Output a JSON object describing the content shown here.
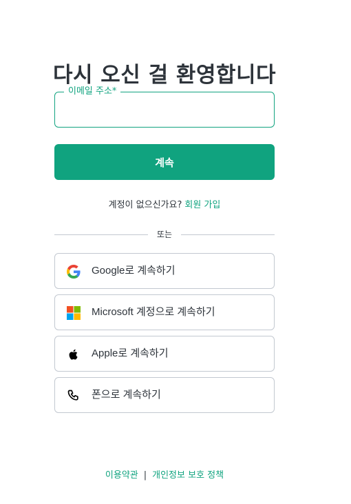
{
  "title": "다시 오신 걸 환영합니다",
  "email": {
    "label": "이메일 주소*",
    "value": "",
    "placeholder": ""
  },
  "continue_label": "계속",
  "signup": {
    "prompt": "계정이 없으신가요?",
    "link_label": "회원 가입"
  },
  "divider_label": "또는",
  "social": {
    "google": {
      "label": "Google로 계속하기",
      "icon": "google-icon"
    },
    "microsoft": {
      "label": "Microsoft 계정으로 계속하기",
      "icon": "microsoft-icon"
    },
    "apple": {
      "label": "Apple로 계속하기",
      "icon": "apple-icon"
    },
    "phone": {
      "label": "폰으로 계속하기",
      "icon": "phone-icon"
    }
  },
  "footer": {
    "terms_label": "이용약관",
    "separator": "|",
    "privacy_label": "개인정보 보호 정책"
  },
  "colors": {
    "accent": "#10a37f",
    "text": "#2d333a",
    "border": "#c2c8d0"
  }
}
